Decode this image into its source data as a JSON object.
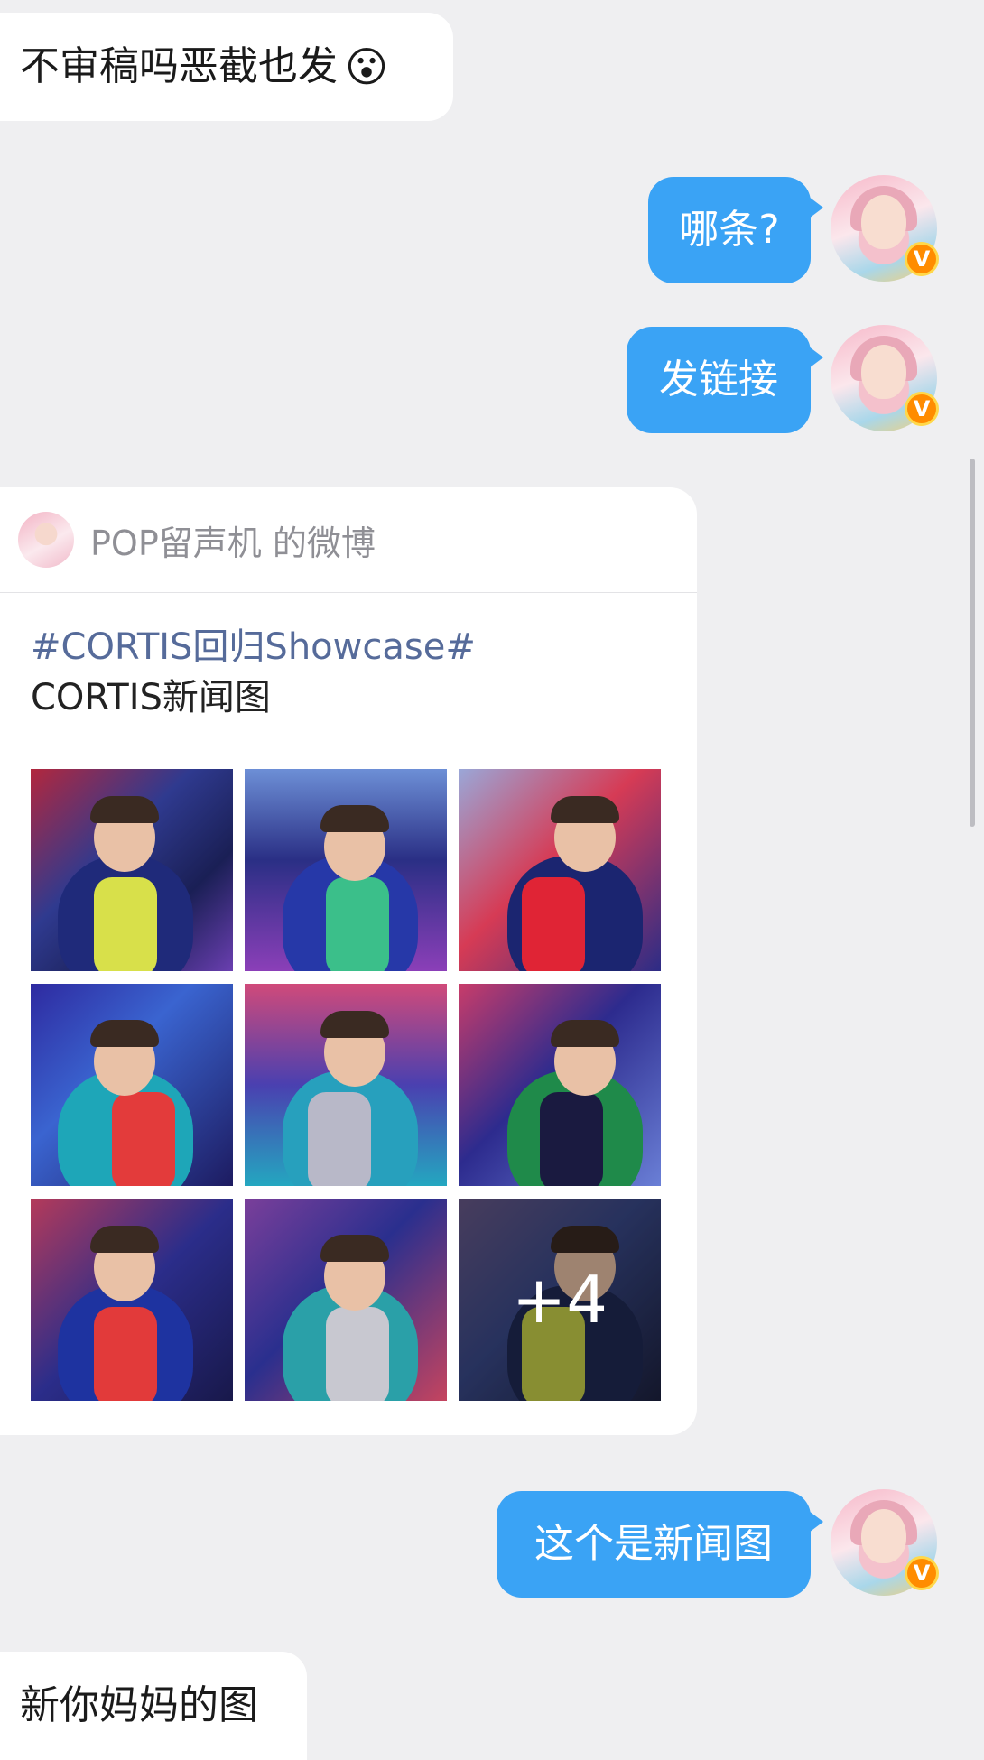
{
  "messages": {
    "m1": "不审稿吗恶截也发",
    "m1_emoji": "😮",
    "m2": "哪条?",
    "m3": "发链接",
    "m4": "这个是新闻图",
    "m5": "新你妈妈的图"
  },
  "card": {
    "source": "POP留声机 的微博",
    "topic": "#CORTIS回归Showcase#",
    "caption": "CORTIS新闻图",
    "more_count": "+4",
    "photos": [
      {
        "bg": "linear-gradient(135deg,#b2273d 0%,#2f3a8f 40%,#1a1f55 70%,#6a3fb0 100%)",
        "jacket": "#1f2a7a",
        "accent": "#d8e04a"
      },
      {
        "bg": "linear-gradient(180deg,#6d8fd6 0%,#2a2f85 45%,#8b3fb8 100%)",
        "jacket": "#2638a8",
        "accent": "#3bbf8a"
      },
      {
        "bg": "linear-gradient(135deg,#9aa7d8 0%,#d63b55 45%,#2c2c86 100%)",
        "jacket": "#1b2570",
        "accent": "#e02435"
      },
      {
        "bg": "linear-gradient(135deg,#2e2aa0 0%,#3a64d0 40%,#1d1b60 100%)",
        "jacket": "#1ea6b8",
        "accent": "#e33b3b"
      },
      {
        "bg": "linear-gradient(180deg,#d04a7a 0%,#4a40b0 50%,#24a7c0 100%)",
        "jacket": "#27a0bd",
        "accent": "#b8b8c8"
      },
      {
        "bg": "linear-gradient(135deg,#c83c6a 0%,#2d2b8e 45%,#6a7fd6 100%)",
        "jacket": "#1f8a4a",
        "accent": "#1a1a40"
      },
      {
        "bg": "linear-gradient(135deg,#b43a5a 0%,#2b2d8a 50%,#18184a 100%)",
        "jacket": "#1e33a0",
        "accent": "#e23a3a"
      },
      {
        "bg": "linear-gradient(135deg,#7a3f9a 0%,#2a2f8e 45%,#c5445f 100%)",
        "jacket": "#2aa0a8",
        "accent": "#c8c8d0"
      },
      {
        "bg": "linear-gradient(135deg,#6a5a8a 0%,#3a4a8a 45%,#1d2240 100%)",
        "jacket": "#1f2a55",
        "accent": "#c9d14a"
      }
    ]
  },
  "badge_label": "V"
}
